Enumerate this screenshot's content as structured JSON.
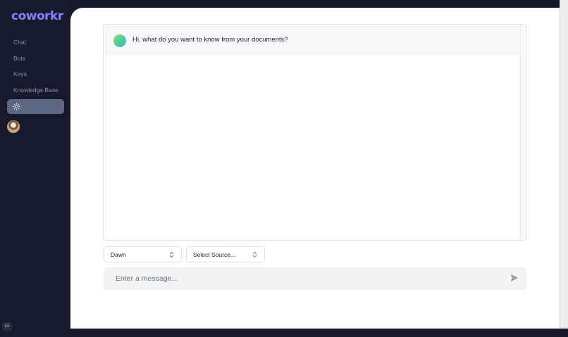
{
  "app": {
    "logo": "coworkr"
  },
  "sidebar": {
    "items": [
      {
        "label": "Chat"
      },
      {
        "label": "Bots"
      },
      {
        "label": "Keys"
      },
      {
        "label": "Knowledge Base"
      }
    ],
    "theme_icon": "sun-icon",
    "avatar_icon": "user-avatar"
  },
  "corner_badge": "x1",
  "chat": {
    "messages": [
      {
        "role": "bot",
        "text": "Hi, what do you want to know from your documents?"
      }
    ]
  },
  "controls": {
    "bot_select": {
      "value": "Dawn",
      "icon": "chevron-up-down-icon"
    },
    "source_select": {
      "value": "Select Source...",
      "icon": "chevron-up-down-icon"
    }
  },
  "composer": {
    "placeholder": "Enter a message...",
    "send_icon": "send-icon"
  },
  "colors": {
    "sidebar_bg": "#161a2c",
    "logo": "#8a80ff",
    "theme_button": "#5d6781",
    "main_bg": "#ffffff",
    "input_bg": "#f2f3f5"
  }
}
